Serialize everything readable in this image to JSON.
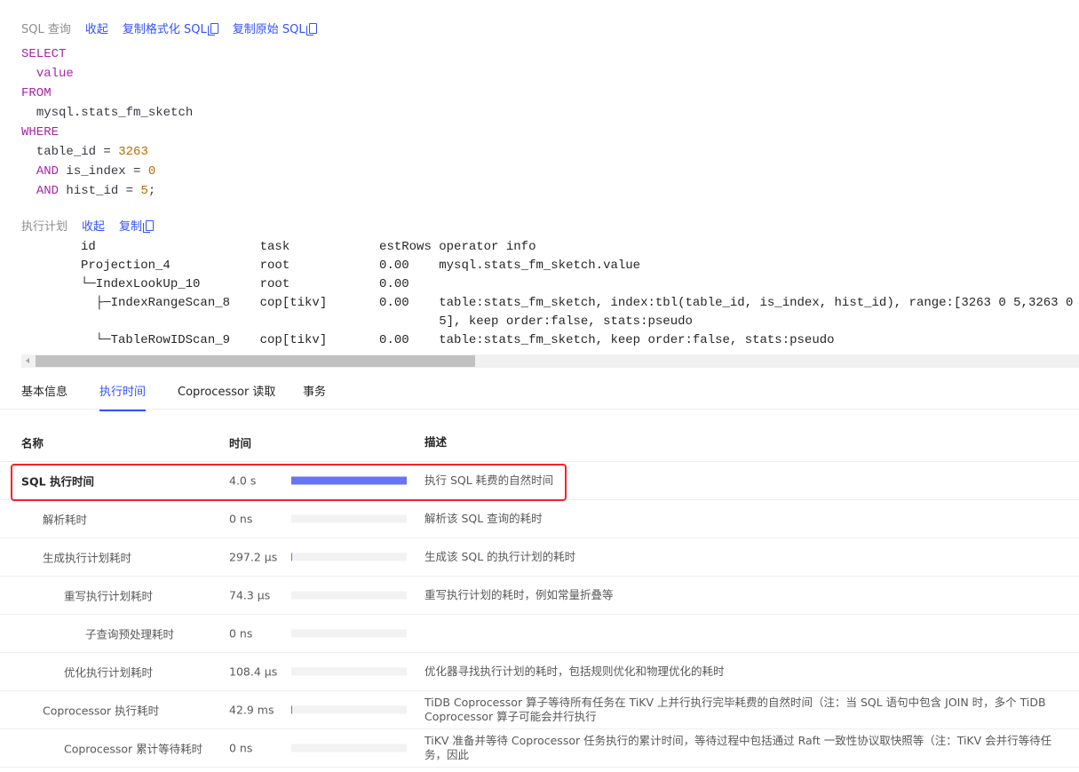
{
  "sql_header": {
    "label": "SQL 查询",
    "collapse": "收起",
    "copy_formatted": "复制格式化 SQL",
    "copy_raw": "复制原始 SQL"
  },
  "sql": {
    "l1": "SELECT",
    "l2": "value",
    "l3": "FROM",
    "l4": "mysql.stats_fm_sketch",
    "l5": "WHERE",
    "l6a": "table_id = ",
    "l6b": "3263",
    "and": "AND",
    "l7a": " is_index = ",
    "l7b": "0",
    "l8a": " hist_id = ",
    "l8b": "5",
    ";": ";"
  },
  "plan_header": {
    "label": "执行计划",
    "collapse": "收起",
    "copy": "复制"
  },
  "plan": {
    "rows": [
      {
        "id": "id",
        "task": "task",
        "est": "estRows",
        "info": "operator info"
      },
      {
        "id": "Projection_4",
        "task": "root",
        "est": "0.00",
        "info": "mysql.stats_fm_sketch.value"
      },
      {
        "id": "└─IndexLookUp_10",
        "task": "root",
        "est": "0.00",
        "info": ""
      },
      {
        "id": "  ├─IndexRangeScan_8",
        "task": "cop[tikv]",
        "est": "0.00",
        "info": "table:stats_fm_sketch, index:tbl(table_id, is_index, hist_id), range:[3263 0 5,3263 0 5], keep order:false, stats:pseudo"
      },
      {
        "id": "  └─TableRowIDScan_9",
        "task": "cop[tikv]",
        "est": "0.00",
        "info": "table:stats_fm_sketch, keep order:false, stats:pseudo"
      }
    ]
  },
  "tabs": [
    {
      "label": "基本信息"
    },
    {
      "label": "执行时间"
    },
    {
      "label": "Coprocessor 读取"
    },
    {
      "label": "事务"
    }
  ],
  "active_tab": "执行时间",
  "table": {
    "headers": {
      "name": "名称",
      "time": "时间",
      "desc": "描述"
    },
    "rows": [
      {
        "name": "SQL 执行时间",
        "time": "4.0 s",
        "fraction": 1.0,
        "desc": "执行 SQL 耗费的自然时间"
      },
      {
        "name": "解析耗时",
        "time": "0 ns",
        "fraction": 0,
        "desc": "解析该 SQL 查询的耗时"
      },
      {
        "name": "生成执行计划耗时",
        "time": "297.2 µs",
        "fraction": 0.0001,
        "desc": "生成该 SQL 的执行计划的耗时"
      },
      {
        "name": "重写执行计划耗时",
        "time": "74.3 µs",
        "fraction": 0,
        "desc": "重写执行计划的耗时，例如常量折叠等"
      },
      {
        "name": "子查询预处理耗时",
        "time": "0 ns",
        "fraction": 0,
        "desc": ""
      },
      {
        "name": "优化执行计划耗时",
        "time": "108.4 µs",
        "fraction": 0,
        "desc": "优化器寻找执行计划的耗时，包括规则优化和物理优化的耗时"
      },
      {
        "name": "Coprocessor 执行耗时",
        "time": "42.9 ms",
        "fraction": 0.0107,
        "desc": "TiDB Coprocessor 算子等待所有任务在 TiKV 上并行执行完毕耗费的自然时间（注：当 SQL 语句中包含 JOIN 时，多个 TiDB Coprocessor 算子可能会并行执行"
      },
      {
        "name": "Coprocessor 累计等待耗时",
        "time": "0 ns",
        "fraction": 0,
        "desc": "TiKV 准备并等待 Coprocessor 任务执行的累计时间，等待过程中包括通过 Raft 一致性协议取快照等（注：TiKV 会并行等待任务，因此"
      }
    ]
  },
  "colors": {
    "accent": "#3351ff",
    "bar": "#6674f5",
    "highlight": "#f5222d"
  }
}
